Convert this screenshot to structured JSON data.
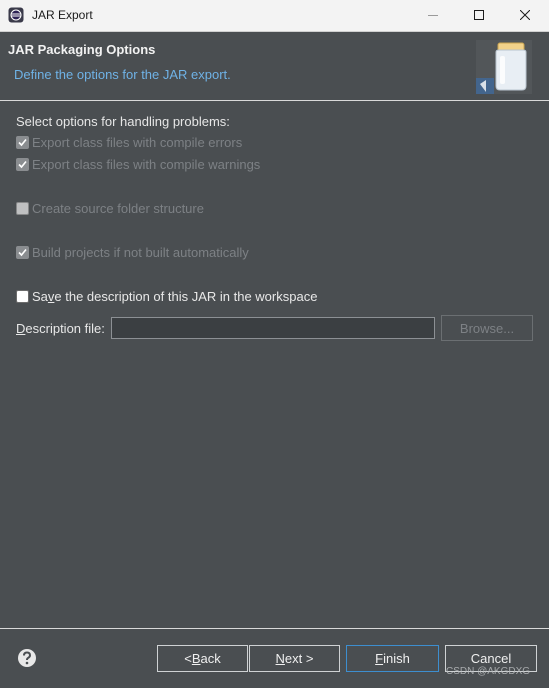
{
  "window": {
    "title": "JAR Export",
    "controls": [
      "minimize",
      "maximize",
      "close"
    ]
  },
  "banner": {
    "title": "JAR Packaging Options",
    "description": "Define the options for the JAR export.",
    "icon": "jar-icon"
  },
  "options": {
    "section_label": "Select options for handling problems:",
    "items": [
      {
        "label": "Export class files with compile errors",
        "checked": true,
        "enabled": false
      },
      {
        "label": "Export class files with compile warnings",
        "checked": true,
        "enabled": false
      },
      {
        "label": "Create source folder structure",
        "checked": false,
        "enabled": false
      },
      {
        "label": "Build projects if not built automatically",
        "checked": true,
        "enabled": false
      },
      {
        "label_prefix": "Sa",
        "label_mnemonic": "v",
        "label_suffix": "e the description of this JAR in the workspace",
        "checked": false,
        "enabled": true
      }
    ]
  },
  "description_file": {
    "label_mnemonic": "D",
    "label_rest": "escription file:",
    "value": "",
    "browse_label": "Browse..."
  },
  "footer": {
    "help_icon": "help-icon",
    "back_prefix": "< ",
    "back_mnemonic": "B",
    "back_rest": "ack",
    "next_mnemonic": "N",
    "next_rest": "ext >",
    "finish_mnemonic": "F",
    "finish_rest": "inish",
    "cancel_label": "Cancel"
  },
  "watermark": "CSDN @AKGDXG",
  "colors": {
    "background": "#4a4e51",
    "accent_text": "#6fb2e6",
    "default_button_border": "#3d8ecf"
  }
}
